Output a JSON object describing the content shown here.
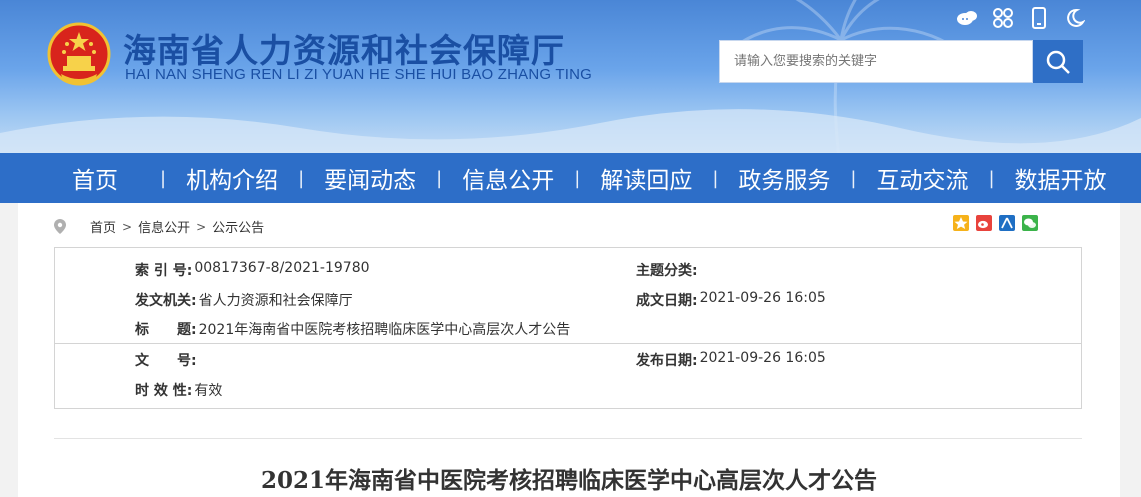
{
  "header": {
    "title_cn": "海南省人力资源和社会保障厅",
    "title_en": "HAI NAN SHENG REN LI ZI YUAN HE SHE HUI BAO ZHANG TING",
    "emblem_icon": "national-emblem-icon",
    "top_icons": [
      "weibo-icon",
      "accessibility-icon",
      "mobile-icon",
      "night-mode-icon"
    ],
    "search": {
      "placeholder": "请输入您要搜索的关键字",
      "button_icon": "search-icon"
    }
  },
  "nav": {
    "items": [
      "首页",
      "机构介绍",
      "要闻动态",
      "信息公开",
      "解读回应",
      "政务服务",
      "互动交流",
      "数据开放"
    ]
  },
  "breadcrumb": {
    "icon": "location-pin-icon",
    "items": [
      "首页",
      "信息公开",
      "公示公告"
    ]
  },
  "share_icons": [
    "qzone-icon",
    "weibo-share-icon",
    "renren-icon",
    "wechat-icon"
  ],
  "meta": {
    "index_label": "索 引 号:",
    "index_value": "00817367-8/2021-19780",
    "topic_label": "主题分类:",
    "topic_value": "",
    "issuer_label": "发文机关:",
    "issuer_value": "省人力资源和社会保障厅",
    "created_label": "成文日期:",
    "created_value": "2021-09-26 16:05",
    "title_label": "标　　题:",
    "title_value": "2021年海南省中医院考核招聘临床医学中心高层次人才公告",
    "doc_no_label": "文　　号:",
    "doc_no_value": "",
    "published_label": "发布日期:",
    "published_value": "2021-09-26 16:05",
    "validity_label": "时 效 性:",
    "validity_value": "有效"
  },
  "article": {
    "title": "2021年海南省中医院考核招聘临床医学中心高层次人才公告"
  },
  "colors": {
    "nav_bg": "#2d6ec8",
    "title_blue": "#1a4fa3",
    "search_btn": "#2f6fc6"
  }
}
